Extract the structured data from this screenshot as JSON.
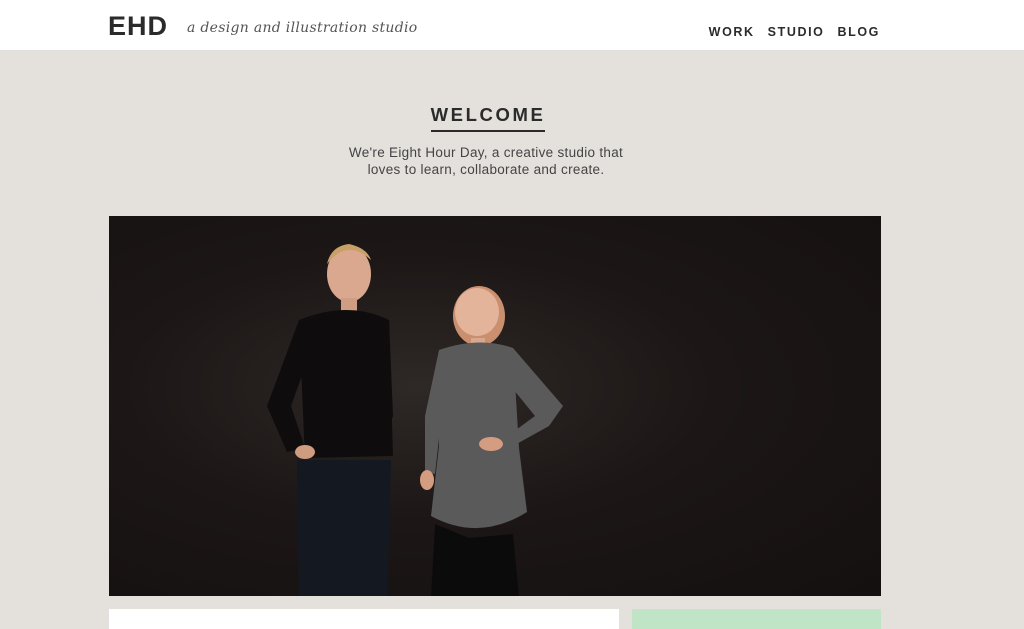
{
  "header": {
    "logo": "EHD",
    "tagline": "a design and illustration studio",
    "nav": [
      "WORK",
      "STUDIO",
      "BLOG"
    ]
  },
  "welcome": {
    "title": "WELCOME",
    "intro_line1": "We're Eight Hour Day, a creative studio that",
    "intro_line2": "loves to learn, collaborate and create."
  },
  "colors": {
    "page_bg": "#e4e1dd",
    "header_bg": "#ffffff",
    "text": "#2b2b2b",
    "photo_bg": "#1c1716",
    "card_right": "#bfe4c6"
  }
}
